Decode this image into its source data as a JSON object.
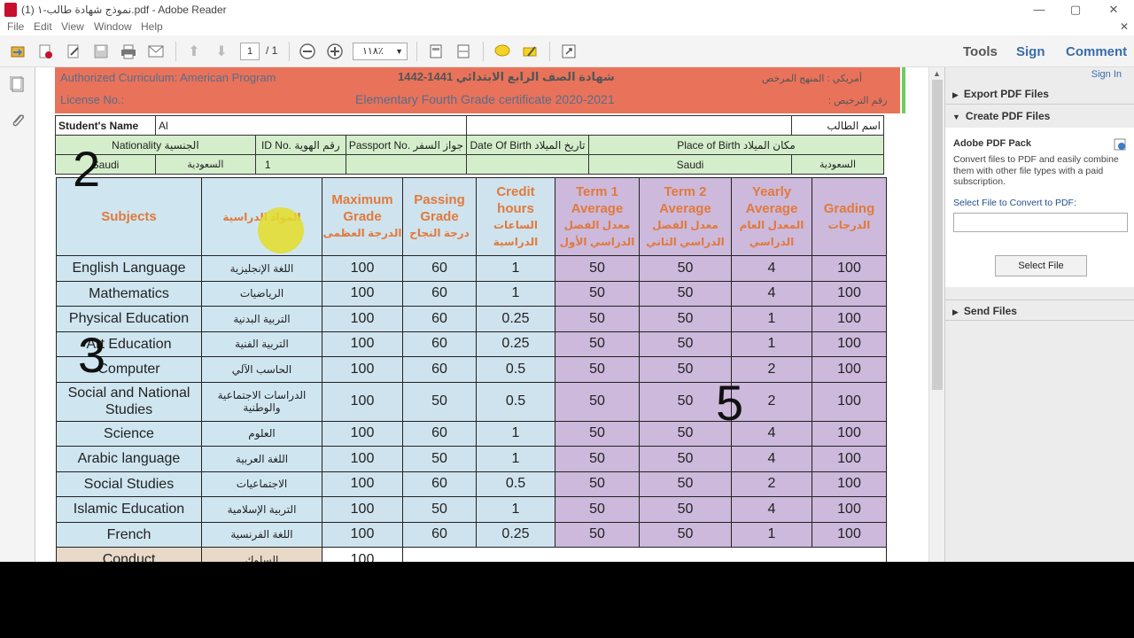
{
  "window": {
    "title": "نموذج شهادة طالب-١ (1).pdf - Adobe Reader",
    "controls": {
      "minimize": "—",
      "maximize": "▢",
      "close": "✕"
    }
  },
  "menu": [
    "File",
    "Edit",
    "View",
    "Window",
    "Help"
  ],
  "toolbar": {
    "page_current": "1",
    "page_total": "/ 1",
    "zoom": "١١٨٪",
    "tools": "Tools",
    "sign": "Sign",
    "comment": "Comment"
  },
  "document": {
    "header": {
      "left_top": "Authorized Curriculum: American Program",
      "arabic_title": "1442-1441  شهادة الصف  الرابع الابتدائي",
      "arabic_right_top": "أمريكي     :  المنهج المرخص",
      "left_bottom": "License No.:",
      "english_title": "Elementary Fourth Grade certificate 2020-2021",
      "arabic_right_bottom": ": رقم الترخيص"
    },
    "info": {
      "student_name_label": "Student's Name",
      "student_name_value": "Al",
      "student_name_ar_label": "اسم الطالب",
      "nationality_label": "Nationality الجنسية",
      "id_label": "ID No. رقم الهوية",
      "passport_label": "Passport No. جواز السفر",
      "dob_label": "Date Of Birth تاريخ الميلاد",
      "pob_label": "Place of Birth مكان الميلاد",
      "nationality_en": "Saudi",
      "nationality_ar": "السعودية",
      "id_value": "1",
      "pob_en": "Saudi",
      "pob_ar": "السعودية"
    },
    "grades_header": {
      "subjects": "Subjects",
      "subjects_ar": "المواد الدراسية",
      "max_grade": "Maximum Grade",
      "max_grade_ar": "الدرجة العظمى",
      "passing": "Passing Grade",
      "passing_ar": "درجة النجاح",
      "credit": "Credit hours",
      "credit_ar": "الساعات الدراسية",
      "term1": "Term 1 Average",
      "term1_ar": "معدل الفصل الدراسي الأول",
      "term2": "Term 2 Average",
      "term2_ar": "معدل الفصل الدراسي الثاني",
      "yearly": "Yearly Average",
      "yearly_ar": "المعدل العام الدراسي",
      "grading": "Grading",
      "grading_ar": "الدرجات"
    },
    "rows": [
      {
        "en": "English Language",
        "ar": "اللغة الإنجليزية",
        "max": "100",
        "pass": "60",
        "credit": "1",
        "t1": "50",
        "t2": "50",
        "year": "4",
        "grade": "100"
      },
      {
        "en": "Mathematics",
        "ar": "الرياضيات",
        "max": "100",
        "pass": "60",
        "credit": "1",
        "t1": "50",
        "t2": "50",
        "year": "4",
        "grade": "100"
      },
      {
        "en": "Physical Education",
        "ar": "التربية البدنية",
        "max": "100",
        "pass": "60",
        "credit": "0.25",
        "t1": "50",
        "t2": "50",
        "year": "1",
        "grade": "100"
      },
      {
        "en": "Art Education",
        "ar": "التربية الفنية",
        "max": "100",
        "pass": "60",
        "credit": "0.25",
        "t1": "50",
        "t2": "50",
        "year": "1",
        "grade": "100"
      },
      {
        "en": "Computer",
        "ar": "الحاسب الآلي",
        "max": "100",
        "pass": "60",
        "credit": "0.5",
        "t1": "50",
        "t2": "50",
        "year": "2",
        "grade": "100"
      },
      {
        "en": "Social and National Studies",
        "ar": "الدراسات الاجتماعية والوطنية",
        "max": "100",
        "pass": "50",
        "credit": "0.5",
        "t1": "50",
        "t2": "50",
        "year": "2",
        "grade": "100"
      },
      {
        "en": "Science",
        "ar": "العلوم",
        "max": "100",
        "pass": "60",
        "credit": "1",
        "t1": "50",
        "t2": "50",
        "year": "4",
        "grade": "100"
      },
      {
        "en": "Arabic language",
        "ar": "اللغة العربية",
        "max": "100",
        "pass": "50",
        "credit": "1",
        "t1": "50",
        "t2": "50",
        "year": "4",
        "grade": "100"
      },
      {
        "en": "Social Studies",
        "ar": "الاجتماعيات",
        "max": "100",
        "pass": "60",
        "credit": "0.5",
        "t1": "50",
        "t2": "50",
        "year": "2",
        "grade": "100"
      },
      {
        "en": "Islamic Education",
        "ar": "التربية الإسلامية",
        "max": "100",
        "pass": "50",
        "credit": "1",
        "t1": "50",
        "t2": "50",
        "year": "4",
        "grade": "100"
      },
      {
        "en": "French",
        "ar": "اللغة الفرنسية",
        "max": "100",
        "pass": "60",
        "credit": "0.25",
        "t1": "50",
        "t2": "50",
        "year": "1",
        "grade": "100"
      }
    ],
    "conduct": {
      "en": "Conduct",
      "ar": "السلوك",
      "max": "100"
    },
    "annotations": {
      "n2": "2",
      "n3": "3",
      "n5": "5"
    }
  },
  "right_panel": {
    "sign_in": "Sign In",
    "export": "Export PDF Files",
    "create": "Create PDF Files",
    "pack_title": "Adobe PDF Pack",
    "pack_desc": "Convert files to PDF and easily combine them with other file types with a paid subscription.",
    "select_label": "Select File to Convert to PDF:",
    "select_button": "Select File",
    "send": "Send Files"
  },
  "colors": {
    "header_bg": "#e8735a",
    "info_bg": "#d4eecb",
    "subject_bg": "#cfe6f1",
    "middle_bg": "#cfe3ee",
    "right_bg": "#cdb9dc",
    "orange_text": "#e07a3c"
  }
}
